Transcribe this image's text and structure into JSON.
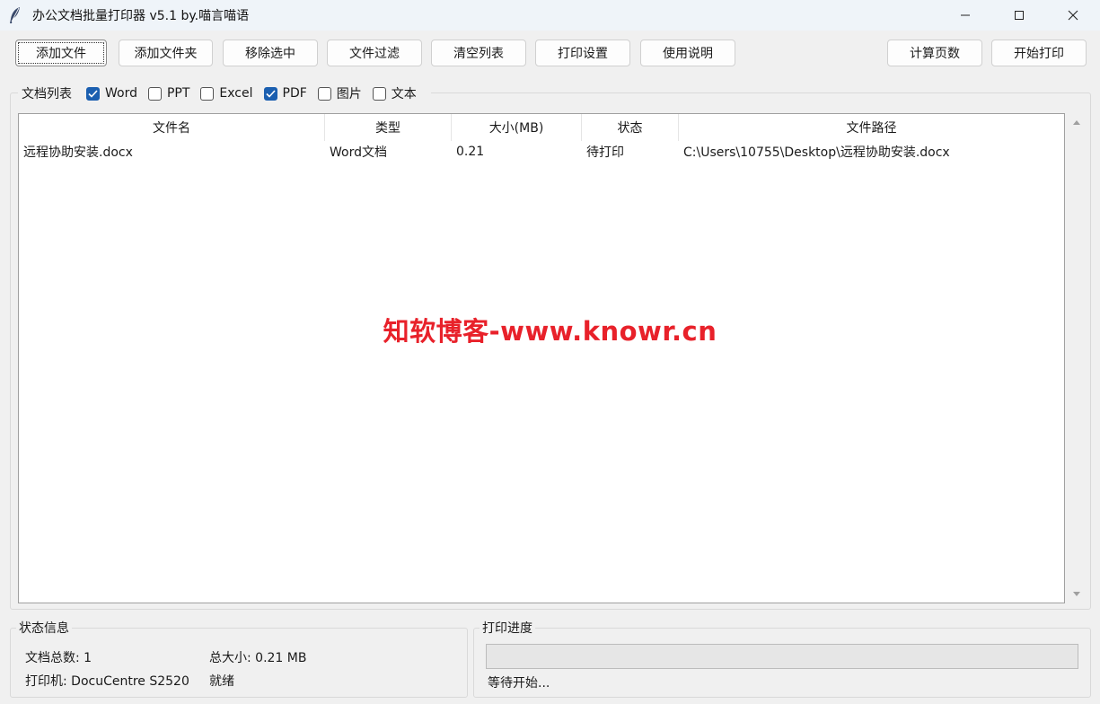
{
  "window": {
    "title": "办公文档批量打印器 v5.1 by.喵言喵语"
  },
  "toolbar": {
    "buttons": [
      {
        "label": "添加文件"
      },
      {
        "label": "添加文件夹"
      },
      {
        "label": "移除选中"
      },
      {
        "label": "文件过滤"
      },
      {
        "label": "清空列表"
      },
      {
        "label": "打印设置"
      },
      {
        "label": "使用说明"
      },
      {
        "label": "计算页数"
      },
      {
        "label": "开始打印"
      }
    ]
  },
  "doc_list": {
    "title": "文档列表",
    "filters": [
      {
        "label": "Word",
        "checked": true
      },
      {
        "label": "PPT",
        "checked": false
      },
      {
        "label": "Excel",
        "checked": false
      },
      {
        "label": "PDF",
        "checked": true
      },
      {
        "label": "图片",
        "checked": false
      },
      {
        "label": "文本",
        "checked": false
      }
    ],
    "columns": [
      "文件名",
      "类型",
      "大小(MB)",
      "状态",
      "文件路径"
    ],
    "rows": [
      [
        "远程协助安装.docx",
        "Word文档",
        "0.21",
        "待打印",
        "C:\\Users\\10755\\Desktop\\远程协助安装.docx"
      ]
    ]
  },
  "watermark": "知软博客-www.knowr.cn",
  "status": {
    "title": "状态信息",
    "doc_count": "文档总数: 1",
    "total_size": "总大小: 0.21 MB",
    "printer": "打印机: DocuCentre S2520",
    "state": "就绪"
  },
  "progress": {
    "title": "打印进度",
    "percent": 0,
    "text": "等待开始..."
  },
  "colors": {
    "checkbox_checked": "#1b5fb0",
    "watermark": "#e8212a",
    "titlebar_bg": "#eff4f9",
    "window_bg": "#f0f0f0"
  }
}
